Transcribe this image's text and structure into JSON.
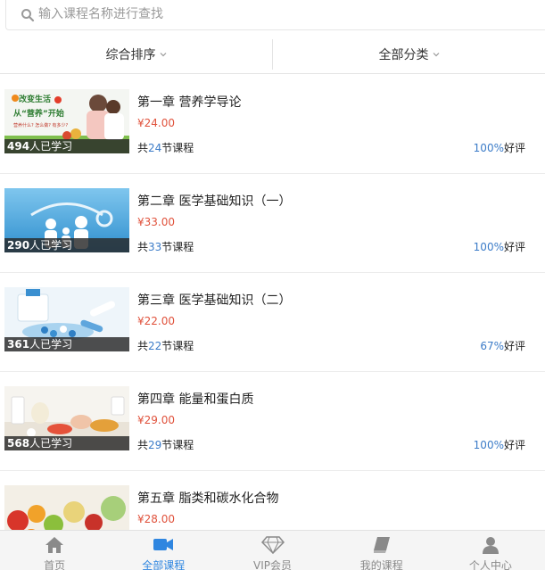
{
  "search": {
    "placeholder": "输入课程名称进行查找"
  },
  "filters": [
    {
      "label": "综合排序"
    },
    {
      "label": "全部分类"
    }
  ],
  "courses": [
    {
      "title": "第一章 营养学导论",
      "price": "¥24.00",
      "learners_num": "494",
      "learners_suffix": "人已学习",
      "lessons_prefix": "共",
      "lessons_num": "24",
      "lessons_suffix": "节课程",
      "rating_num": "100%",
      "rating_suffix": "好评",
      "thumb_text": [
        "改变生活",
        "从“营养”开始",
        "营养什么? 怎么做? 有多少?"
      ]
    },
    {
      "title": "第二章 医学基础知识（一）",
      "price": "¥33.00",
      "learners_num": "290",
      "learners_suffix": "人已学习",
      "lessons_prefix": "共",
      "lessons_num": "33",
      "lessons_suffix": "节课程",
      "rating_num": "100%",
      "rating_suffix": "好评"
    },
    {
      "title": "第三章 医学基础知识（二）",
      "price": "¥22.00",
      "learners_num": "361",
      "learners_suffix": "人已学习",
      "lessons_prefix": "共",
      "lessons_num": "22",
      "lessons_suffix": "节课程",
      "rating_num": "67%",
      "rating_suffix": "好评"
    },
    {
      "title": "第四章 能量和蛋白质",
      "price": "¥29.00",
      "learners_num": "568",
      "learners_suffix": "人已学习",
      "lessons_prefix": "共",
      "lessons_num": "29",
      "lessons_suffix": "节课程",
      "rating_num": "100%",
      "rating_suffix": "好评"
    },
    {
      "title": "第五章 脂类和碳水化合物",
      "price": "¥28.00"
    }
  ],
  "tabbar": [
    {
      "label": "首页",
      "icon": "home-icon"
    },
    {
      "label": "全部课程",
      "icon": "video-camera-icon",
      "active": true
    },
    {
      "label": "VIP会员",
      "icon": "diamond-icon"
    },
    {
      "label": "我的课程",
      "icon": "book-icon"
    },
    {
      "label": "个人中心",
      "icon": "user-icon"
    }
  ],
  "colors": {
    "accent": "#2f86e0",
    "price": "#e0523c",
    "highlight_num": "#3c7cc8",
    "tab_inactive": "#8a8a8a"
  }
}
